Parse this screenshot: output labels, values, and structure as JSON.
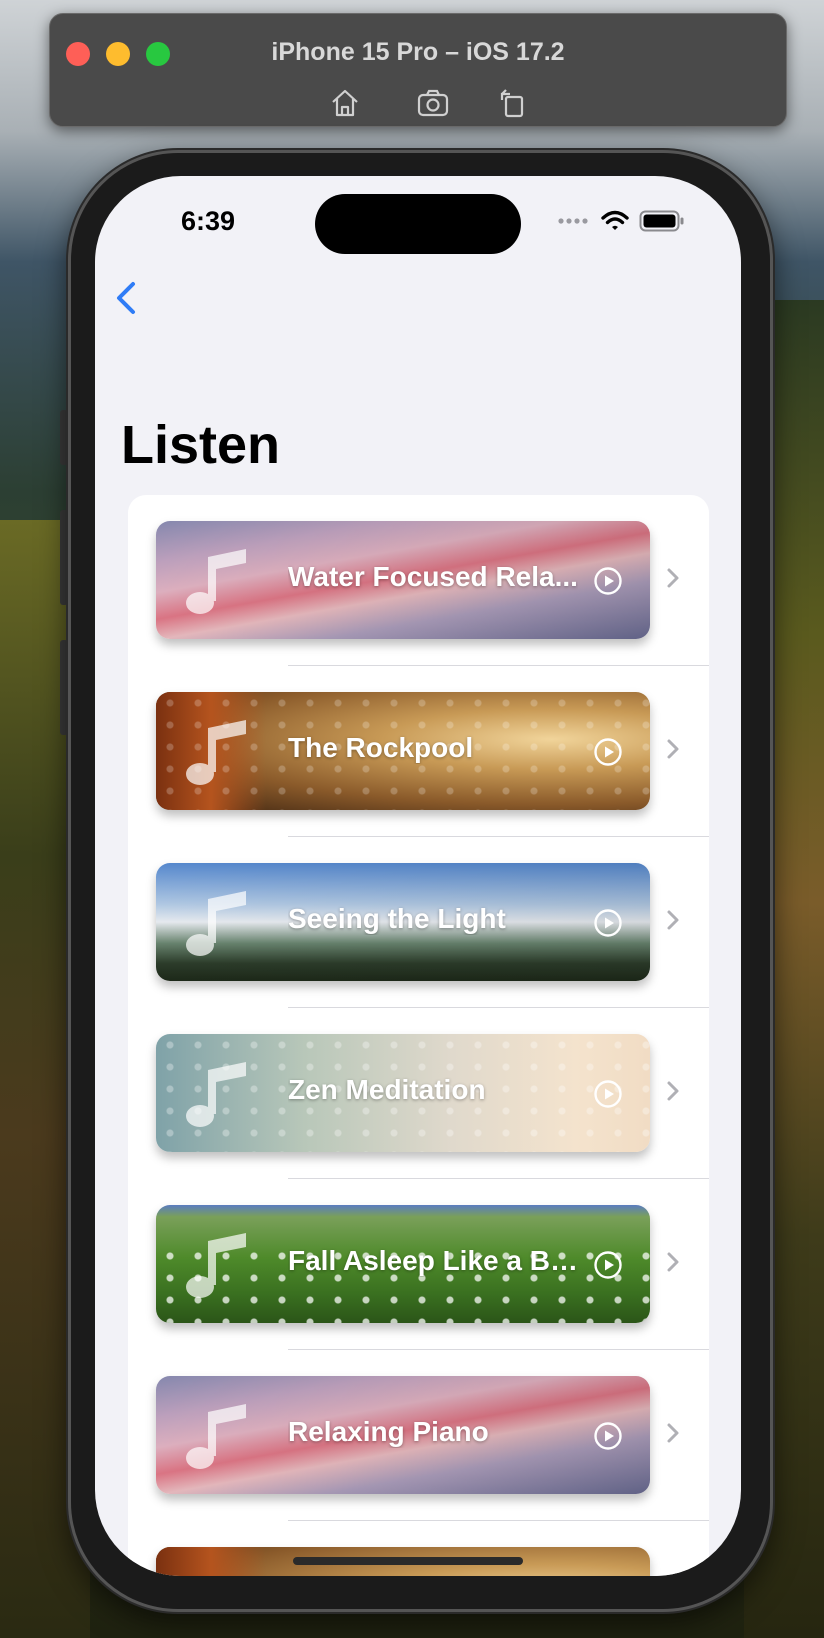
{
  "simulator": {
    "title": "iPhone 15 Pro – iOS 17.2",
    "tools": [
      "home-icon",
      "screenshot-icon",
      "rotate-icon"
    ]
  },
  "status_bar": {
    "time": "6:39",
    "icons": [
      "signal-icon",
      "wifi-icon",
      "battery-icon"
    ]
  },
  "nav": {
    "back_icon": "chevron-left-icon",
    "title": "Listen"
  },
  "colors": {
    "accent": "#2f7cf6",
    "background": "#f2f2f7",
    "list_background": "#ffffff",
    "chevron": "#b0b0b5"
  },
  "tracks": [
    {
      "title": "Water Focused Rela...",
      "image": "sunset-clouds"
    },
    {
      "title": "The Rockpool",
      "image": "golden-bokeh"
    },
    {
      "title": "Seeing the Light",
      "image": "mountain-sky"
    },
    {
      "title": "Zen Meditation",
      "image": "pastel-wildflowers"
    },
    {
      "title": "Fall Asleep Like a Ba...",
      "image": "daisy-meadow"
    },
    {
      "title": "Relaxing Piano",
      "image": "sunset-clouds"
    },
    {
      "title": "",
      "image": "golden-bokeh"
    }
  ]
}
